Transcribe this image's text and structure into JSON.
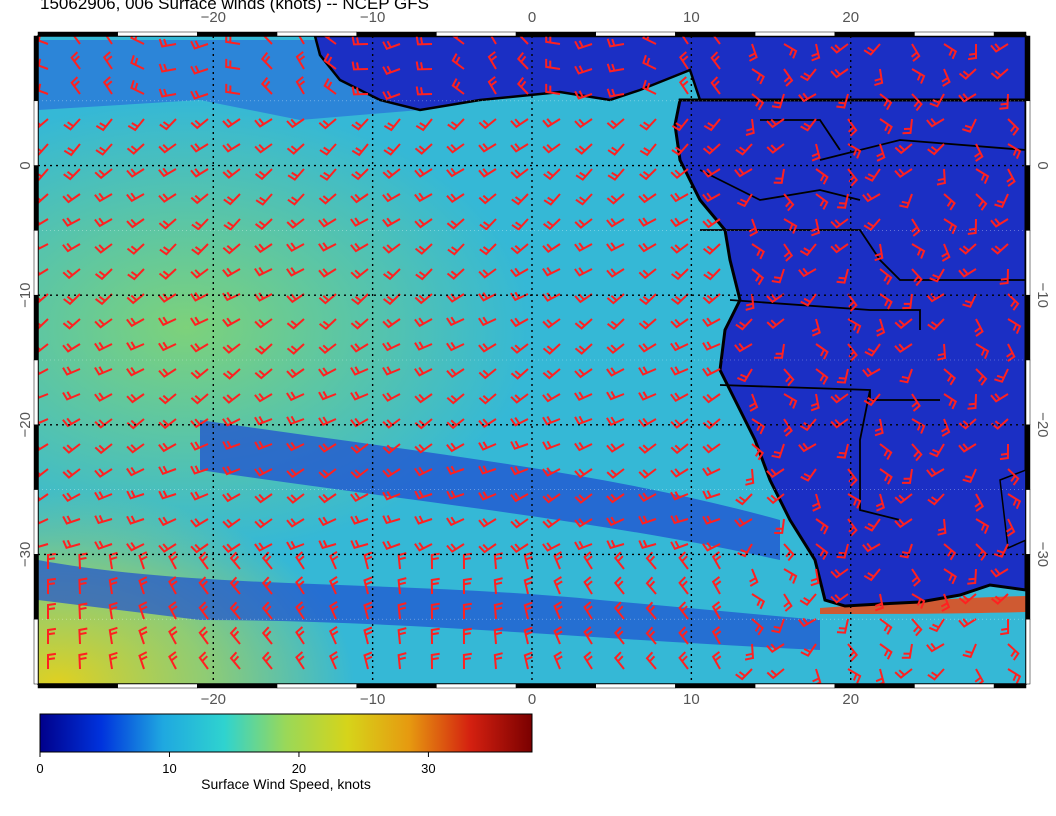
{
  "title": "15062906, 006 Surface winds (knots) -- NCEP GFS",
  "map": {
    "lon_range": [
      -31,
      31
    ],
    "lat_range": [
      10,
      -40
    ],
    "lon_ticks": [
      {
        "value": -20,
        "label": "−20"
      },
      {
        "value": -10,
        "label": "−10"
      },
      {
        "value": 0,
        "label": "0"
      },
      {
        "value": 10,
        "label": "10"
      },
      {
        "value": 20,
        "label": "20"
      }
    ],
    "lat_ticks": [
      {
        "value": 0,
        "label": "0"
      },
      {
        "value": -10,
        "label": "−10"
      },
      {
        "value": -20,
        "label": "−20"
      },
      {
        "value": -30,
        "label": "−30"
      }
    ],
    "barb_color": "#ff2020",
    "ocean_color": "#3ac4d8",
    "land_color": "#1a2ec8"
  },
  "colorbar": {
    "label": "Surface Wind Speed, knots",
    "range": [
      0,
      38
    ],
    "ticks": [
      {
        "value": 0,
        "label": "0"
      },
      {
        "value": 10,
        "label": "10"
      },
      {
        "value": 20,
        "label": "20"
      },
      {
        "value": 30,
        "label": "30"
      }
    ],
    "stops": [
      "#00008b",
      "#0033dd",
      "#1fa8e0",
      "#2fd3cf",
      "#9ad858",
      "#d6d41a",
      "#e69a10",
      "#d42010",
      "#7a0000"
    ]
  }
}
